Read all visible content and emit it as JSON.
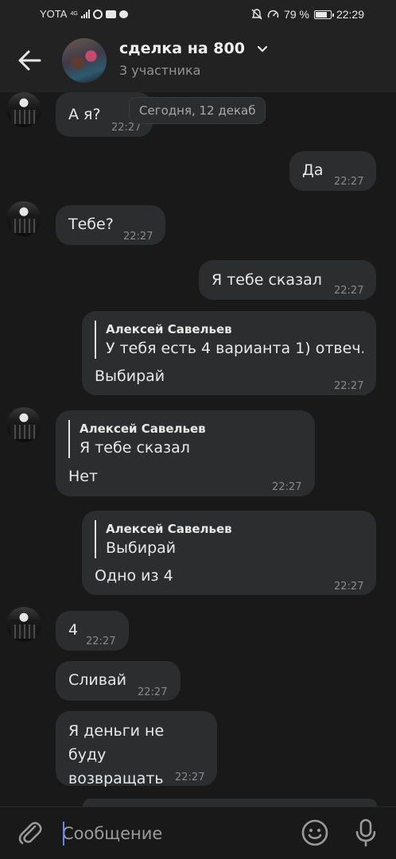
{
  "status_bar": {
    "carrier": "YOTA",
    "network": "4G",
    "battery_pct": "79 %",
    "time": "22:29"
  },
  "header": {
    "title": "сделка на 800",
    "subtitle": "3 участника"
  },
  "date_label": "Сегодня, 12 декаб",
  "messages": [
    {
      "text": "А я?",
      "time": "22:27"
    },
    {
      "text": "Да",
      "time": "22:27"
    },
    {
      "text": "Тебе?",
      "time": "22:27"
    },
    {
      "text": "Я тебе сказал",
      "time": "22:27"
    },
    {
      "quote_author": "Алексей Савельев",
      "quote_text": "У тебя есть 4 варианта 1) отвеч...",
      "text": "Выбирай",
      "time": "22:27"
    },
    {
      "quote_author": "Алексей Савельев",
      "quote_text": "Я тебе сказал",
      "text": "Нет",
      "time": "22:27"
    },
    {
      "quote_author": "Алексей Савельев",
      "quote_text": "Выбирай",
      "text": "Одно из 4",
      "time": "22:27"
    },
    {
      "text": "4",
      "time": "22:27"
    },
    {
      "text": "Сливай",
      "time": "22:27"
    },
    {
      "text": "Я деньги не буду возвращать",
      "time": "22:27"
    }
  ],
  "composer": {
    "placeholder": "Сообщение"
  }
}
